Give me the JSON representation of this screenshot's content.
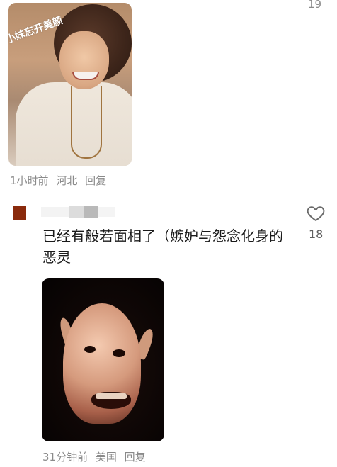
{
  "top_comment": {
    "like_count": "19",
    "image": {
      "watermark": "小妹忘开美颜"
    },
    "meta": {
      "time": "1小时前",
      "location": "河北",
      "reply_label": "回复"
    }
  },
  "comment": {
    "text": "已经有般若面相了（嫉妒与怨念化身的恶灵",
    "like_count": "18",
    "avatar_color": "#8a2a0c",
    "meta": {
      "time": "31分钟前",
      "location": "美国",
      "reply_label": "回复"
    }
  },
  "icons": {
    "like": "heart-outline-icon"
  }
}
